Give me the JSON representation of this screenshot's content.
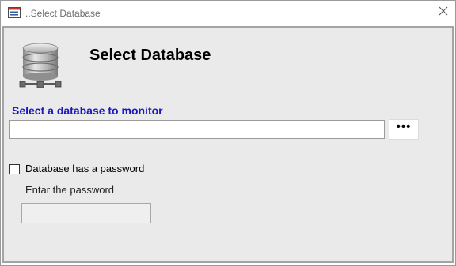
{
  "window": {
    "title": "..Select Database"
  },
  "icons": {
    "app": "form-window-icon",
    "close": "close-icon",
    "database": "database-network-icon"
  },
  "dialog": {
    "heading": "Select Database",
    "prompt": "Select a database to monitor",
    "path_value": "",
    "browse_label": "•••",
    "password_checkbox": {
      "label": "Database has a password",
      "checked": false
    },
    "password_label": "Entar the password",
    "password_value": ""
  },
  "colors": {
    "client_background": "#eaeaea",
    "prompt_text": "#1818c0",
    "title_text": "#6d6d6d"
  }
}
